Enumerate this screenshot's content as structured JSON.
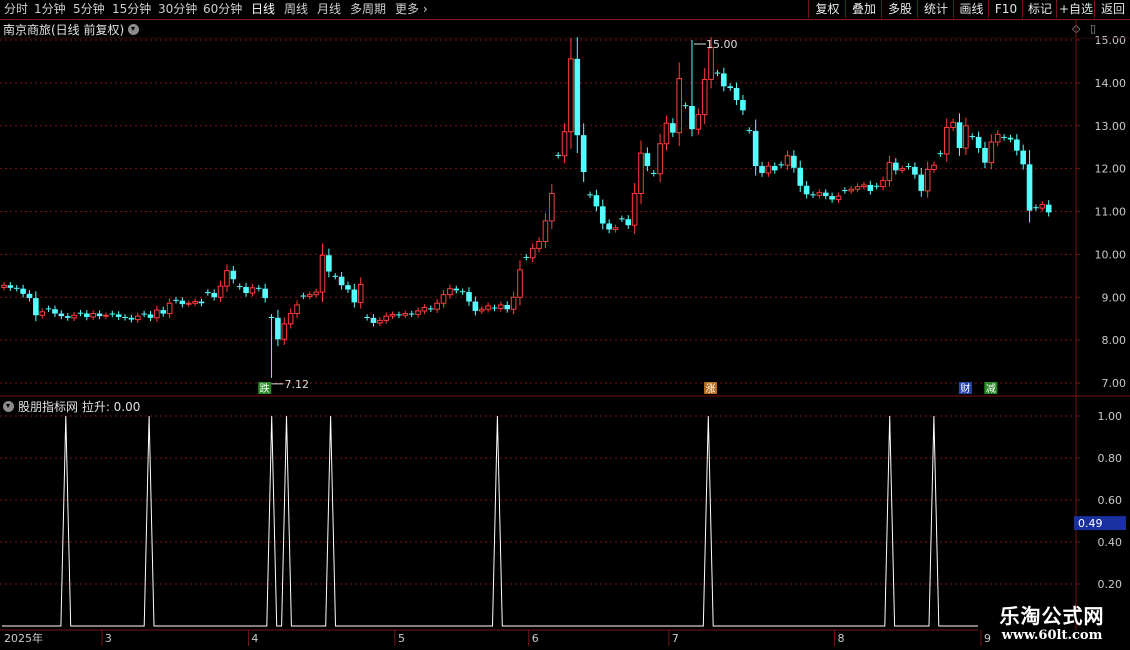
{
  "toolbar": {
    "periods": [
      "分时",
      "1分钟",
      "5分钟",
      "15分钟",
      "30分钟",
      "60分钟",
      "日线",
      "周线",
      "月线",
      "多周期",
      "更多"
    ],
    "active_period": "日线",
    "buttons": [
      "复权",
      "叠加",
      "多股",
      "统计",
      "画线",
      "F10",
      "标记",
      "+自选",
      "返回"
    ]
  },
  "chart_title": "南京商旅(日线 前复权)",
  "indicator_title": "股朋指标网 拉升: 0.00",
  "watermark": {
    "line1": "乐淘公式网",
    "line2": "www.60lt.com"
  },
  "colors": {
    "up": "#ff3c3c",
    "down": "#54ffff",
    "grid": "#7a1515",
    "line": "#ffffff",
    "axis_text": "#c9c9c9",
    "axis_box": "#1a2fa0"
  },
  "chart_data": [
    {
      "type": "candlestick",
      "ylim": [
        7.0,
        15.0
      ],
      "yticks": [
        "15.00",
        "14.00",
        "13.00",
        "12.00",
        "11.00",
        "10.00",
        "9.00",
        "8.00",
        "7.00"
      ],
      "annotations": {
        "high": "15.00",
        "low": "7.12"
      },
      "markers": [
        {
          "label": "跌",
          "color": "#2a8a2a",
          "index": 41
        },
        {
          "label": "涨",
          "color": "#b56b20",
          "index": 111
        },
        {
          "label": "财",
          "color": "#2646a8",
          "index": 151
        },
        {
          "label": "减",
          "color": "#2a8a2a",
          "index": 155
        }
      ],
      "x_labels": [
        {
          "text": "2025年",
          "index": 0
        },
        {
          "text": "3",
          "index": 16
        },
        {
          "text": "4",
          "index": 39
        },
        {
          "text": "5",
          "index": 62
        },
        {
          "text": "6",
          "index": 83
        },
        {
          "text": "7",
          "index": 105
        },
        {
          "text": "8",
          "index": 131
        },
        {
          "text": "9",
          "index": 154
        }
      ],
      "close": [
        9.28,
        9.22,
        9.2,
        9.08,
        8.98,
        8.58,
        8.66,
        8.72,
        8.62,
        8.56,
        8.52,
        8.58,
        8.62,
        8.54,
        8.62,
        8.56,
        8.58,
        8.6,
        8.54,
        8.52,
        8.48,
        8.56,
        8.6,
        8.52,
        8.7,
        8.62,
        8.86,
        8.92,
        8.84,
        8.86,
        8.9,
        8.86,
        9.1,
        9.0,
        9.26,
        9.62,
        9.42,
        9.24,
        9.1,
        9.22,
        9.2,
        8.98,
        8.52,
        8.02,
        8.38,
        8.62,
        8.82,
        9.02,
        9.06,
        9.12,
        9.98,
        9.6,
        9.48,
        9.28,
        9.18,
        8.88,
        9.3,
        8.52,
        8.4,
        8.46,
        8.56,
        8.6,
        8.58,
        8.62,
        8.6,
        8.68,
        8.76,
        8.72,
        8.86,
        9.06,
        9.2,
        9.16,
        9.12,
        8.9,
        8.68,
        8.72,
        8.8,
        8.74,
        8.82,
        8.72,
        9.0,
        9.64,
        9.92,
        10.14,
        10.3,
        10.78,
        11.42,
        12.3,
        12.86,
        14.56,
        12.78,
        11.92,
        11.38,
        11.12,
        10.72,
        10.58,
        10.62,
        10.82,
        10.68,
        11.42,
        12.36,
        12.06,
        11.88,
        12.58,
        13.06,
        12.84,
        14.1,
        13.46,
        12.92,
        13.26,
        14.08,
        14.82,
        14.22,
        13.92,
        13.88,
        13.6,
        13.36,
        12.88,
        12.06,
        11.9,
        12.06,
        11.96,
        12.08,
        12.3,
        12.02,
        11.6,
        11.4,
        11.38,
        11.44,
        11.36,
        11.28,
        11.36,
        11.48,
        11.52,
        11.58,
        11.62,
        11.48,
        11.58,
        11.72,
        12.14,
        11.96,
        12.0,
        12.04,
        11.86,
        11.48,
        11.98,
        12.08,
        12.34,
        12.96,
        13.08,
        12.48,
        13.0,
        12.74,
        12.48,
        12.14,
        12.62,
        12.8,
        12.72,
        12.68,
        12.42,
        12.1,
        11.02,
        11.08,
        11.16,
        10.98
      ],
      "series": [
        {
          "name": "拉升",
          "type": "line",
          "ylim": [
            0,
            1.08
          ],
          "yticks": [
            "1.00",
            "0.80",
            "0.60",
            "0.40",
            "0.20"
          ],
          "current_value": "0.49",
          "spike_indices": [
            13,
            30,
            55,
            58,
            67,
            101,
            144,
            181,
            190
          ],
          "length": 200
        }
      ]
    }
  ]
}
